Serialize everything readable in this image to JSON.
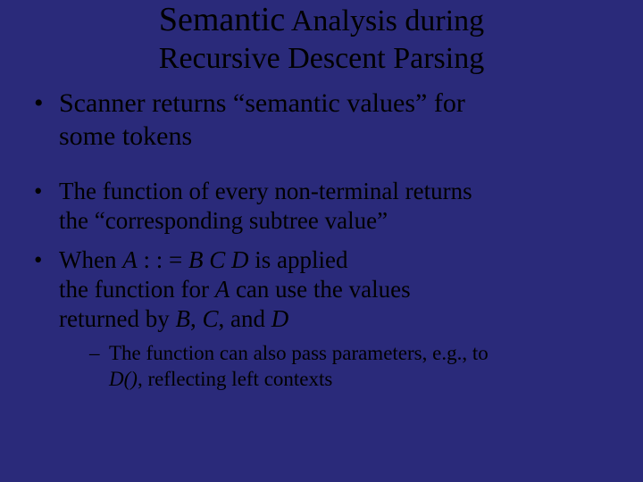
{
  "title_line1_a": "Semantic",
  "title_line1_b": " Analysis during",
  "title_line2": "Recursive Descent Parsing",
  "b1_a": "Scanner returns “semantic values” for",
  "b1_b": "some tokens",
  "b2_a": "The function of every non-terminal returns",
  "b2_b": "the “corresponding subtree value”",
  "b3_pre": "When ",
  "b3_A": "A",
  "b3_mid1": " : : = ",
  "b3_B": "B",
  "b3_sp1": " ",
  "b3_C": "C",
  "b3_sp2": " ",
  "b3_D": "D",
  "b3_post1": " is applied",
  "b3_line2a": "the function for ",
  "b3_A2": "A",
  "b3_line2b": " can use the values",
  "b3_line3a": "returned by ",
  "b3_B2": "B",
  "b3_comma1": ", ",
  "b3_C2": "C",
  "b3_comma2": ", and ",
  "b3_D2": "D",
  "sub_a": "The function can also pass parameters, e.g., to",
  "sub_Dfn": "D()",
  "sub_b": ", reflecting left contexts"
}
